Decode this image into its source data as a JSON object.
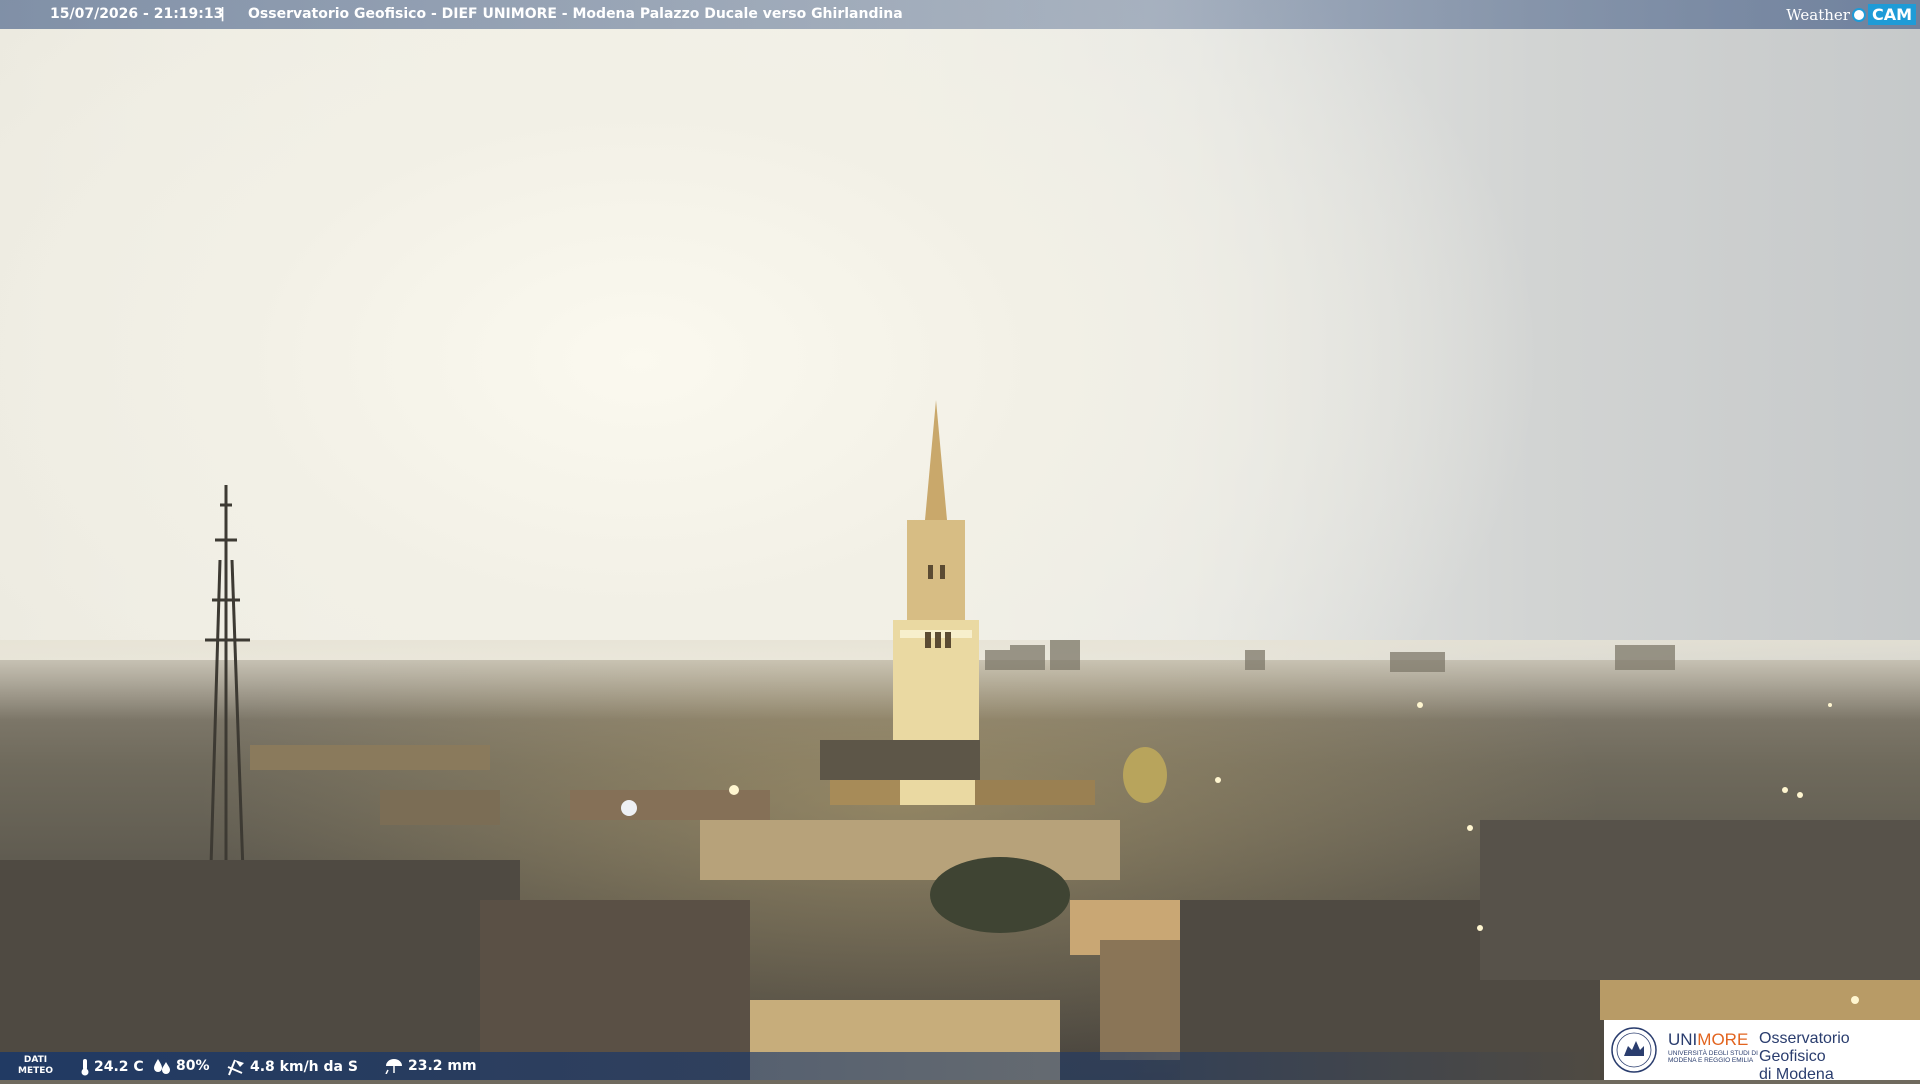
{
  "header": {
    "datetime": "15/07/2026 - 21:19:13",
    "separator": "|",
    "caption": "Osservatorio Geofisico - DIEF UNIMORE - Modena Palazzo Ducale verso Ghirlandina"
  },
  "brand": {
    "weather": "Weather",
    "cam": "CAM",
    "accent": "#1e9bd7"
  },
  "meteo": {
    "label_line1": "DATI",
    "label_line2": "METEO",
    "temperature": "24.2 C",
    "humidity": "80%",
    "wind": "4.8 km/h da S",
    "rain": "23.2 mm",
    "bar_color": "#19376a"
  },
  "logo": {
    "name_a": "UNI",
    "name_b": "MORE",
    "subtitle": "UNIVERSITÀ DEGLI STUDI DI MODENA E REGGIO EMILIA",
    "observatory_line1": "Osservatorio Geofisico",
    "observatory_line2": "di Modena",
    "name_color": "#2a3d6e",
    "more_color": "#e2641f"
  },
  "icons": [
    "thermometer-icon",
    "humidity-icon",
    "wind-icon",
    "rain-icon",
    "unimore-seal-icon"
  ]
}
